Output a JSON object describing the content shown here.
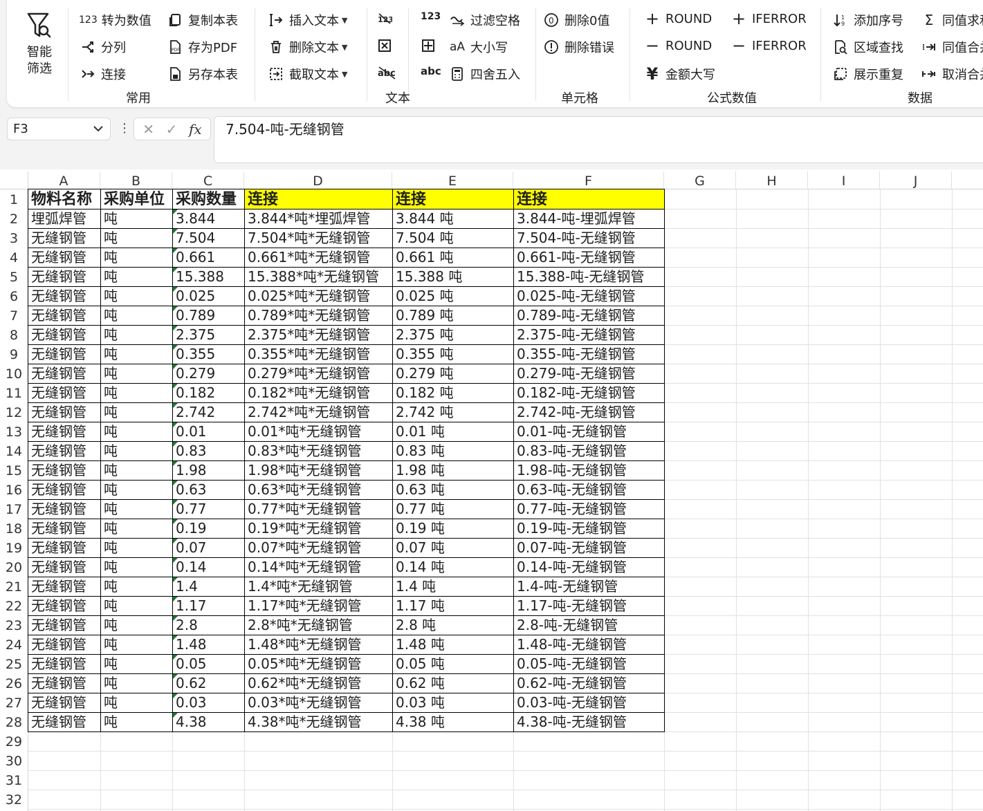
{
  "ribbon": {
    "smart_filter": {
      "line1": "智能",
      "line2": "筛选"
    },
    "common": {
      "to_number": {
        "badge": "123",
        "label": "转为数值"
      },
      "split": "分列",
      "connect": "连接",
      "copy_sheet": "复制本表",
      "save_pdf": "存为PDF",
      "save_sheet": "另存本表",
      "group_label": "常用"
    },
    "text": {
      "insert_text": "插入文本",
      "delete_text": "删除文本",
      "extract_text": "截取文本",
      "filter_space": "过滤空格",
      "case": "大小写",
      "round": "四舍五入",
      "abc_label": "abc",
      "n123_label": "123",
      "group_label": "文本"
    },
    "cell": {
      "delete_zero": "删除0值",
      "delete_error": "删除错误",
      "group_label": "单元格"
    },
    "formula": {
      "add_round": "ROUND",
      "remove_round": "ROUND",
      "add_iferror": "IFERROR",
      "remove_iferror": "IFERROR",
      "amount_upper": "金额大写",
      "group_label": "公式数值"
    },
    "data": {
      "add_seq": "添加序号",
      "range_find": "区域查找",
      "show_dup": "展示重复",
      "same_sum": "同值求和",
      "same_merge": "同值合并",
      "cancel_merge": "取消合并",
      "group_label": "数据"
    }
  },
  "formula_bar": {
    "cell_ref": "F3",
    "formula": "7.504-吨-无缝钢管"
  },
  "columns": [
    "A",
    "B",
    "C",
    "D",
    "E",
    "F",
    "G",
    "H",
    "I",
    "J"
  ],
  "header_row": [
    "物料名称",
    "采购单位",
    "采购数量",
    "连接",
    "连接",
    "连接"
  ],
  "rows": [
    [
      "埋弧焊管",
      "吨",
      "3.844",
      "3.844*吨*埋弧焊管",
      "3.844 吨",
      "3.844-吨-埋弧焊管"
    ],
    [
      "无缝钢管",
      "吨",
      "7.504",
      "7.504*吨*无缝钢管",
      "7.504 吨",
      "7.504-吨-无缝钢管"
    ],
    [
      "无缝钢管",
      "吨",
      "0.661",
      "0.661*吨*无缝钢管",
      "0.661 吨",
      "0.661-吨-无缝钢管"
    ],
    [
      "无缝钢管",
      "吨",
      "15.388",
      "15.388*吨*无缝钢管",
      "15.388 吨",
      "15.388-吨-无缝钢管"
    ],
    [
      "无缝钢管",
      "吨",
      "0.025",
      "0.025*吨*无缝钢管",
      "0.025 吨",
      "0.025-吨-无缝钢管"
    ],
    [
      "无缝钢管",
      "吨",
      "0.789",
      "0.789*吨*无缝钢管",
      "0.789 吨",
      "0.789-吨-无缝钢管"
    ],
    [
      "无缝钢管",
      "吨",
      "2.375",
      "2.375*吨*无缝钢管",
      "2.375 吨",
      "2.375-吨-无缝钢管"
    ],
    [
      "无缝钢管",
      "吨",
      "0.355",
      "0.355*吨*无缝钢管",
      "0.355 吨",
      "0.355-吨-无缝钢管"
    ],
    [
      "无缝钢管",
      "吨",
      "0.279",
      "0.279*吨*无缝钢管",
      "0.279 吨",
      "0.279-吨-无缝钢管"
    ],
    [
      "无缝钢管",
      "吨",
      "0.182",
      "0.182*吨*无缝钢管",
      "0.182 吨",
      "0.182-吨-无缝钢管"
    ],
    [
      "无缝钢管",
      "吨",
      "2.742",
      "2.742*吨*无缝钢管",
      "2.742 吨",
      "2.742-吨-无缝钢管"
    ],
    [
      "无缝钢管",
      "吨",
      "0.01",
      "0.01*吨*无缝钢管",
      "0.01 吨",
      "0.01-吨-无缝钢管"
    ],
    [
      "无缝钢管",
      "吨",
      "0.83",
      "0.83*吨*无缝钢管",
      "0.83 吨",
      "0.83-吨-无缝钢管"
    ],
    [
      "无缝钢管",
      "吨",
      "1.98",
      "1.98*吨*无缝钢管",
      "1.98 吨",
      "1.98-吨-无缝钢管"
    ],
    [
      "无缝钢管",
      "吨",
      "0.63",
      "0.63*吨*无缝钢管",
      "0.63 吨",
      "0.63-吨-无缝钢管"
    ],
    [
      "无缝钢管",
      "吨",
      "0.77",
      "0.77*吨*无缝钢管",
      "0.77 吨",
      "0.77-吨-无缝钢管"
    ],
    [
      "无缝钢管",
      "吨",
      "0.19",
      "0.19*吨*无缝钢管",
      "0.19 吨",
      "0.19-吨-无缝钢管"
    ],
    [
      "无缝钢管",
      "吨",
      "0.07",
      "0.07*吨*无缝钢管",
      "0.07 吨",
      "0.07-吨-无缝钢管"
    ],
    [
      "无缝钢管",
      "吨",
      "0.14",
      "0.14*吨*无缝钢管",
      "0.14 吨",
      "0.14-吨-无缝钢管"
    ],
    [
      "无缝钢管",
      "吨",
      "1.4",
      "1.4*吨*无缝钢管",
      "1.4 吨",
      "1.4-吨-无缝钢管"
    ],
    [
      "无缝钢管",
      "吨",
      "1.17",
      "1.17*吨*无缝钢管",
      "1.17 吨",
      "1.17-吨-无缝钢管"
    ],
    [
      "无缝钢管",
      "吨",
      "2.8",
      "2.8*吨*无缝钢管",
      "2.8 吨",
      "2.8-吨-无缝钢管"
    ],
    [
      "无缝钢管",
      "吨",
      "1.48",
      "1.48*吨*无缝钢管",
      "1.48 吨",
      "1.48-吨-无缝钢管"
    ],
    [
      "无缝钢管",
      "吨",
      "0.05",
      "0.05*吨*无缝钢管",
      "0.05 吨",
      "0.05-吨-无缝钢管"
    ],
    [
      "无缝钢管",
      "吨",
      "0.62",
      "0.62*吨*无缝钢管",
      "0.62 吨",
      "0.62-吨-无缝钢管"
    ],
    [
      "无缝钢管",
      "吨",
      "0.03",
      "0.03*吨*无缝钢管",
      "0.03 吨",
      "0.03-吨-无缝钢管"
    ],
    [
      "无缝钢管",
      "吨",
      "4.38",
      "4.38*吨*无缝钢管",
      "4.38 吨",
      "4.38-吨-无缝钢管"
    ]
  ],
  "row_numbers": [
    "1",
    "2",
    "3",
    "4",
    "5",
    "6",
    "7",
    "8",
    "9",
    "10",
    "11",
    "12",
    "13",
    "14",
    "15",
    "16",
    "17",
    "18",
    "19",
    "20",
    "21",
    "22",
    "23",
    "24",
    "25",
    "26",
    "27",
    "28",
    "29",
    "30",
    "31",
    "32"
  ],
  "colors": {
    "header_highlight": "#ffff00",
    "number_text_marker": "#1e7b34"
  }
}
